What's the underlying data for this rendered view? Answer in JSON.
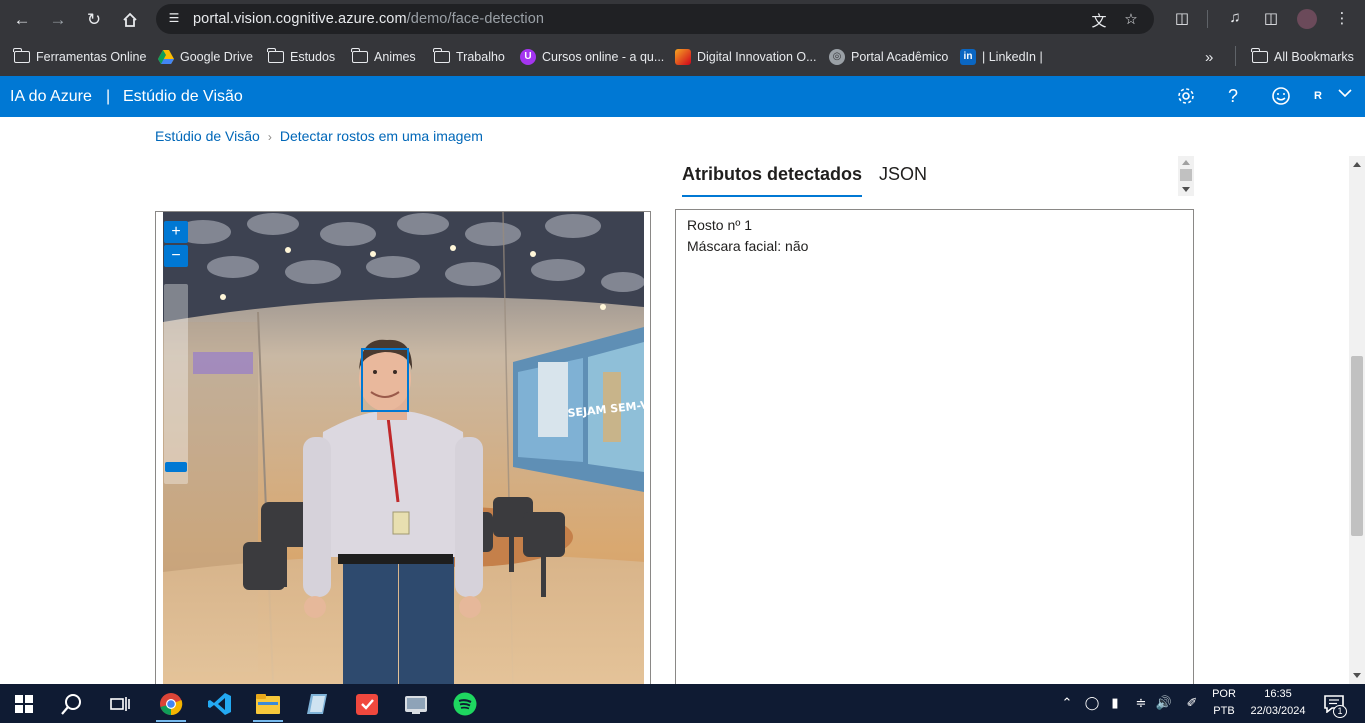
{
  "browser": {
    "url_host": "portal.vision.cognitive.azure.com",
    "url_path": "/demo/face-detection",
    "bookmarks": [
      {
        "label": "Ferramentas Online",
        "icon": "folder-icon"
      },
      {
        "label": "Google Drive",
        "icon": "google-drive-icon"
      },
      {
        "label": "Estudos",
        "icon": "folder-icon"
      },
      {
        "label": "Animes",
        "icon": "folder-icon"
      },
      {
        "label": "Trabalho",
        "icon": "folder-icon"
      },
      {
        "label": "Cursos online - a qu...",
        "icon": "udemy-icon"
      },
      {
        "label": "Digital Innovation O...",
        "icon": "dio-icon"
      },
      {
        "label": "Portal Acadêmico",
        "icon": "globe-icon"
      },
      {
        "label": "| LinkedIn |",
        "icon": "linkedin-icon"
      }
    ],
    "all_bookmarks": "All Bookmarks"
  },
  "header": {
    "title": "IA do Azure",
    "divider": "|",
    "subtitle": "Estúdio de Visão",
    "user_initial": "R",
    "accent": "#0078d4"
  },
  "breadcrumb": {
    "root": "Estúdio de Visão",
    "current": "Detectar rostos em uma imagem"
  },
  "tabs": {
    "attributes": "Atributos detectados",
    "json": "JSON"
  },
  "zoom": {
    "plus": "+",
    "minus": "−"
  },
  "results": {
    "face_label": "Rosto nº 1",
    "mask_label": "Máscara facial: não"
  },
  "taskbar": {
    "language_line1": "POR",
    "language_line2": "PTB",
    "time": "16:35",
    "date": "22/03/2024",
    "notification_count": "1"
  }
}
